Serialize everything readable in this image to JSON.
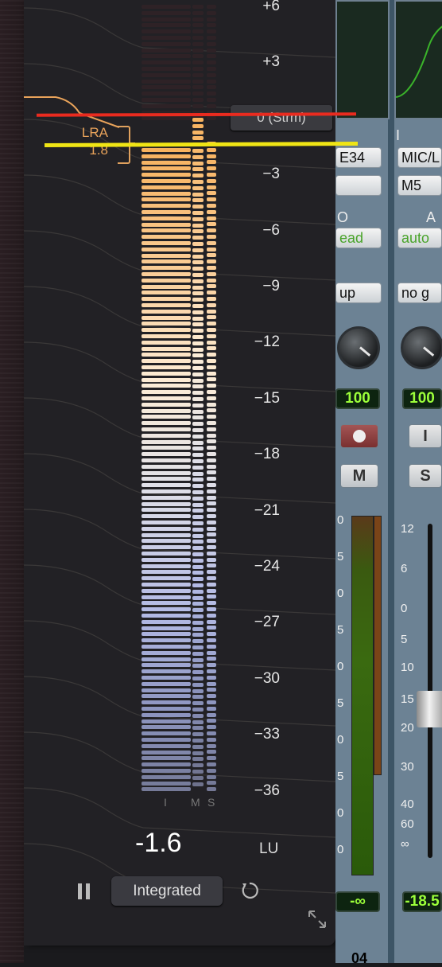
{
  "loudness_meter": {
    "scale_labels": [
      "+6",
      "+3",
      "0 (Strm)",
      "-3",
      "-6",
      "-9",
      "-12",
      "-15",
      "-18",
      "-21",
      "-24",
      "-27",
      "-30",
      "-33",
      "-36"
    ],
    "target_tag": "0 (Strm)",
    "lra_label": "LRA",
    "lra_value": "1.8",
    "channel_labels": {
      "i": "I",
      "m": "M",
      "s": "S"
    },
    "readout_value": "-1.6",
    "readout_unit": "LU",
    "mode_button": "Integrated",
    "pause_icon": "pause-icon",
    "reset_icon": "reset-icon",
    "expand_icon": "expand-icon",
    "colors": {
      "red_line": "#ea2b1f",
      "yellow_line": "#f0e515",
      "lra_orange": "#e9a35a"
    }
  },
  "mixer": {
    "strip1": {
      "insert": "E34",
      "io_label": "O",
      "automation": "ead",
      "group": "up",
      "pan": "100",
      "mute": "M"
    },
    "strip2": {
      "input": "MIC/L",
      "insert2": "M5",
      "io_label": "A",
      "automation": "auto",
      "group": "no g",
      "pan": "100",
      "input_btn": "I",
      "solo": "S",
      "volume": "-18.5"
    },
    "fader_scale": [
      "12",
      "6",
      "0",
      "5",
      "10",
      "15",
      "20",
      "30",
      "40",
      "60",
      "∞"
    ],
    "strip1_meter_scale": [
      "0",
      "5",
      "0",
      "5",
      "0",
      "5",
      "0",
      "5",
      "0",
      "0"
    ],
    "strip1_lcd_bottom": "-∞",
    "bottom_text": "04"
  }
}
